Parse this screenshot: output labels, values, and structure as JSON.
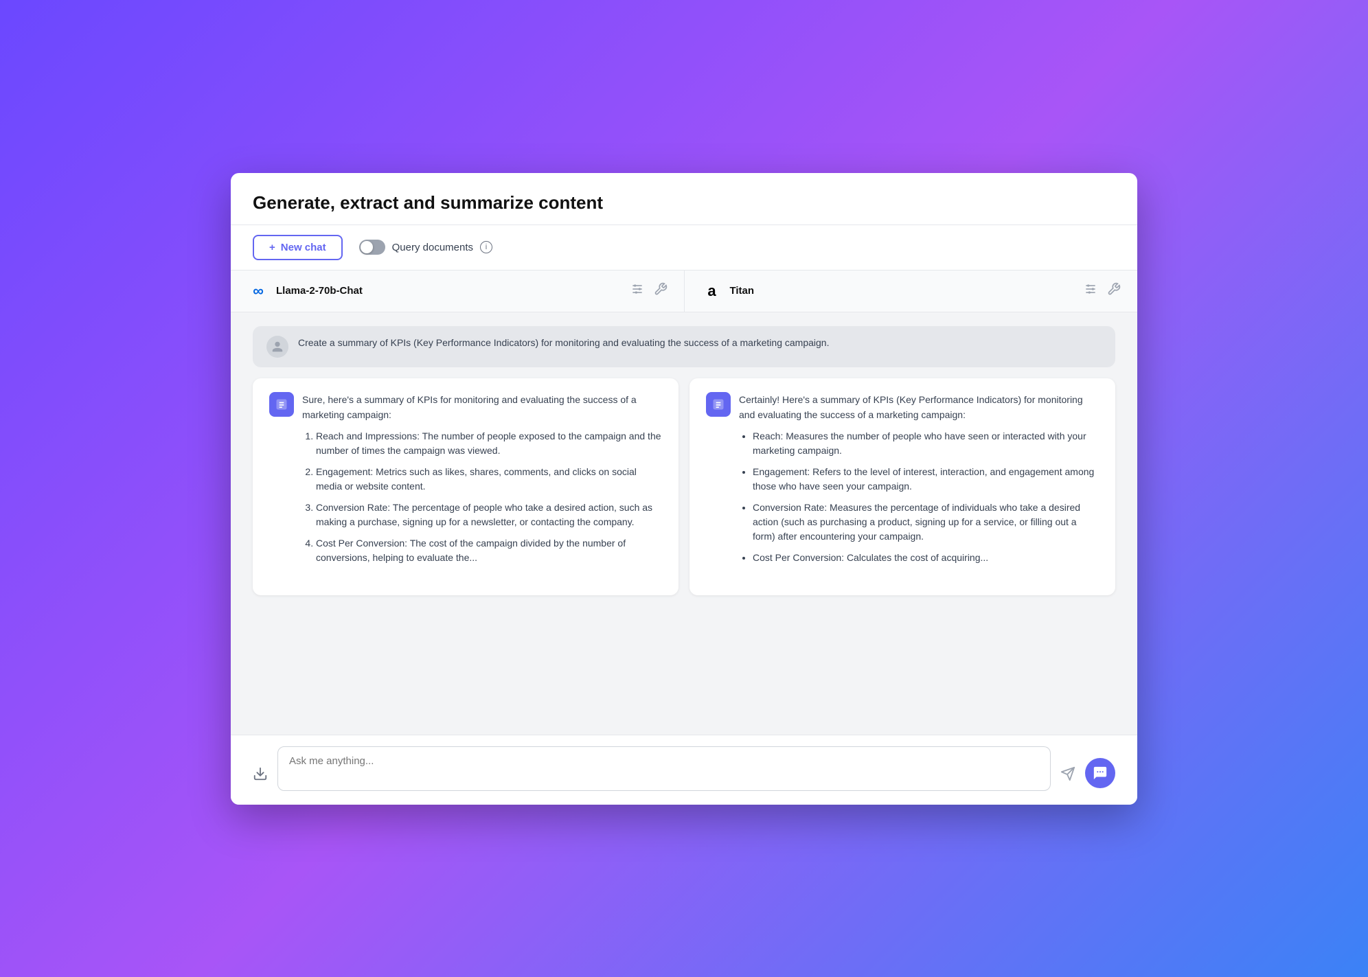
{
  "header": {
    "title": "Generate, extract and summarize content"
  },
  "toolbar": {
    "new_chat_label": "New chat",
    "query_docs_label": "Query documents",
    "info_icon_label": "i"
  },
  "models": [
    {
      "id": "llama",
      "logo_type": "meta",
      "logo_text": "∞",
      "name": "Llama-2-70b-Chat"
    },
    {
      "id": "titan",
      "logo_type": "amazon",
      "logo_text": "a",
      "name": "Titan"
    }
  ],
  "user_message": "Create a summary of KPIs (Key Performance Indicators) for monitoring and evaluating the success of a marketing campaign.",
  "responses": [
    {
      "id": "llama-response",
      "intro": "Sure, here's a summary of KPIs for monitoring and evaluating the success of a marketing campaign:",
      "items": [
        "Reach and Impressions: The number of people exposed to the campaign and the number of times the campaign was viewed.",
        "Engagement: Metrics such as likes, shares, comments, and clicks on social media or website content.",
        "Conversion Rate: The percentage of people who take a desired action, such as making a purchase, signing up for a newsletter, or contacting the company.",
        "Cost Per Conversion: The cost of the campaign divided by the number of conversions, helping to evaluate the..."
      ],
      "list_type": "ol"
    },
    {
      "id": "titan-response",
      "intro": "Certainly! Here's a summary of KPIs (Key Performance Indicators) for monitoring and evaluating the success of a marketing campaign:",
      "items": [
        "Reach: Measures the number of people who have seen or interacted with your marketing campaign.",
        "Engagement: Refers to the level of interest, interaction, and engagement among those who have seen your campaign.",
        "Conversion Rate: Measures the percentage of individuals who take a desired action (such as purchasing a product, signing up for a service, or filling out a form) after encountering your campaign.",
        "Cost Per Conversion: Calculates the cost of acquiring..."
      ],
      "list_type": "ul"
    }
  ],
  "input": {
    "placeholder": "Ask me anything..."
  }
}
